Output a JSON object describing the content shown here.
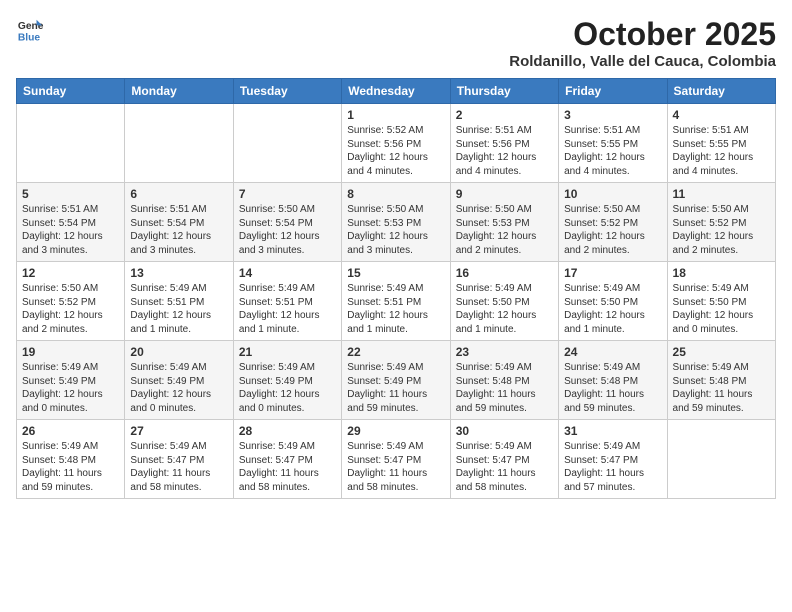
{
  "header": {
    "logo_line1": "General",
    "logo_line2": "Blue",
    "month": "October 2025",
    "location": "Roldanillo, Valle del Cauca, Colombia"
  },
  "days_of_week": [
    "Sunday",
    "Monday",
    "Tuesday",
    "Wednesday",
    "Thursday",
    "Friday",
    "Saturday"
  ],
  "weeks": [
    [
      {
        "day": "",
        "info": ""
      },
      {
        "day": "",
        "info": ""
      },
      {
        "day": "",
        "info": ""
      },
      {
        "day": "1",
        "info": "Sunrise: 5:52 AM\nSunset: 5:56 PM\nDaylight: 12 hours and 4 minutes."
      },
      {
        "day": "2",
        "info": "Sunrise: 5:51 AM\nSunset: 5:56 PM\nDaylight: 12 hours and 4 minutes."
      },
      {
        "day": "3",
        "info": "Sunrise: 5:51 AM\nSunset: 5:55 PM\nDaylight: 12 hours and 4 minutes."
      },
      {
        "day": "4",
        "info": "Sunrise: 5:51 AM\nSunset: 5:55 PM\nDaylight: 12 hours and 4 minutes."
      }
    ],
    [
      {
        "day": "5",
        "info": "Sunrise: 5:51 AM\nSunset: 5:54 PM\nDaylight: 12 hours and 3 minutes."
      },
      {
        "day": "6",
        "info": "Sunrise: 5:51 AM\nSunset: 5:54 PM\nDaylight: 12 hours and 3 minutes."
      },
      {
        "day": "7",
        "info": "Sunrise: 5:50 AM\nSunset: 5:54 PM\nDaylight: 12 hours and 3 minutes."
      },
      {
        "day": "8",
        "info": "Sunrise: 5:50 AM\nSunset: 5:53 PM\nDaylight: 12 hours and 3 minutes."
      },
      {
        "day": "9",
        "info": "Sunrise: 5:50 AM\nSunset: 5:53 PM\nDaylight: 12 hours and 2 minutes."
      },
      {
        "day": "10",
        "info": "Sunrise: 5:50 AM\nSunset: 5:52 PM\nDaylight: 12 hours and 2 minutes."
      },
      {
        "day": "11",
        "info": "Sunrise: 5:50 AM\nSunset: 5:52 PM\nDaylight: 12 hours and 2 minutes."
      }
    ],
    [
      {
        "day": "12",
        "info": "Sunrise: 5:50 AM\nSunset: 5:52 PM\nDaylight: 12 hours and 2 minutes."
      },
      {
        "day": "13",
        "info": "Sunrise: 5:49 AM\nSunset: 5:51 PM\nDaylight: 12 hours and 1 minute."
      },
      {
        "day": "14",
        "info": "Sunrise: 5:49 AM\nSunset: 5:51 PM\nDaylight: 12 hours and 1 minute."
      },
      {
        "day": "15",
        "info": "Sunrise: 5:49 AM\nSunset: 5:51 PM\nDaylight: 12 hours and 1 minute."
      },
      {
        "day": "16",
        "info": "Sunrise: 5:49 AM\nSunset: 5:50 PM\nDaylight: 12 hours and 1 minute."
      },
      {
        "day": "17",
        "info": "Sunrise: 5:49 AM\nSunset: 5:50 PM\nDaylight: 12 hours and 1 minute."
      },
      {
        "day": "18",
        "info": "Sunrise: 5:49 AM\nSunset: 5:50 PM\nDaylight: 12 hours and 0 minutes."
      }
    ],
    [
      {
        "day": "19",
        "info": "Sunrise: 5:49 AM\nSunset: 5:49 PM\nDaylight: 12 hours and 0 minutes."
      },
      {
        "day": "20",
        "info": "Sunrise: 5:49 AM\nSunset: 5:49 PM\nDaylight: 12 hours and 0 minutes."
      },
      {
        "day": "21",
        "info": "Sunrise: 5:49 AM\nSunset: 5:49 PM\nDaylight: 12 hours and 0 minutes."
      },
      {
        "day": "22",
        "info": "Sunrise: 5:49 AM\nSunset: 5:49 PM\nDaylight: 11 hours and 59 minutes."
      },
      {
        "day": "23",
        "info": "Sunrise: 5:49 AM\nSunset: 5:48 PM\nDaylight: 11 hours and 59 minutes."
      },
      {
        "day": "24",
        "info": "Sunrise: 5:49 AM\nSunset: 5:48 PM\nDaylight: 11 hours and 59 minutes."
      },
      {
        "day": "25",
        "info": "Sunrise: 5:49 AM\nSunset: 5:48 PM\nDaylight: 11 hours and 59 minutes."
      }
    ],
    [
      {
        "day": "26",
        "info": "Sunrise: 5:49 AM\nSunset: 5:48 PM\nDaylight: 11 hours and 59 minutes."
      },
      {
        "day": "27",
        "info": "Sunrise: 5:49 AM\nSunset: 5:47 PM\nDaylight: 11 hours and 58 minutes."
      },
      {
        "day": "28",
        "info": "Sunrise: 5:49 AM\nSunset: 5:47 PM\nDaylight: 11 hours and 58 minutes."
      },
      {
        "day": "29",
        "info": "Sunrise: 5:49 AM\nSunset: 5:47 PM\nDaylight: 11 hours and 58 minutes."
      },
      {
        "day": "30",
        "info": "Sunrise: 5:49 AM\nSunset: 5:47 PM\nDaylight: 11 hours and 58 minutes."
      },
      {
        "day": "31",
        "info": "Sunrise: 5:49 AM\nSunset: 5:47 PM\nDaylight: 11 hours and 57 minutes."
      },
      {
        "day": "",
        "info": ""
      }
    ]
  ]
}
